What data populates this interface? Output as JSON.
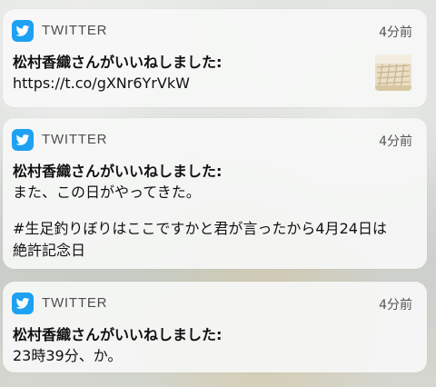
{
  "notifications": [
    {
      "app_name": "TWITTER",
      "time": "4分前",
      "title": "松村香織さんがいいねしました:",
      "body": [
        "https://t.co/gXNr6YrVkW"
      ],
      "has_thumbnail": true
    },
    {
      "app_name": "TWITTER",
      "time": "4分前",
      "title": "松村香織さんがいいねしました:",
      "body_para1": "また、この日がやってきた。",
      "body_para2": [
        "#生足釣りぼりはここですかと君が言ったから4月24日は",
        "絶許記念日"
      ]
    },
    {
      "app_name": "TWITTER",
      "time": "4分前",
      "title": "松村香織さんがいいねしました:",
      "body": [
        "23時39分、か。"
      ]
    }
  ],
  "colors": {
    "twitter_blue": "#1da1f2",
    "card_bg": "#f6f7f6"
  },
  "icons": {
    "app_icon": "twitter-bird-icon"
  }
}
